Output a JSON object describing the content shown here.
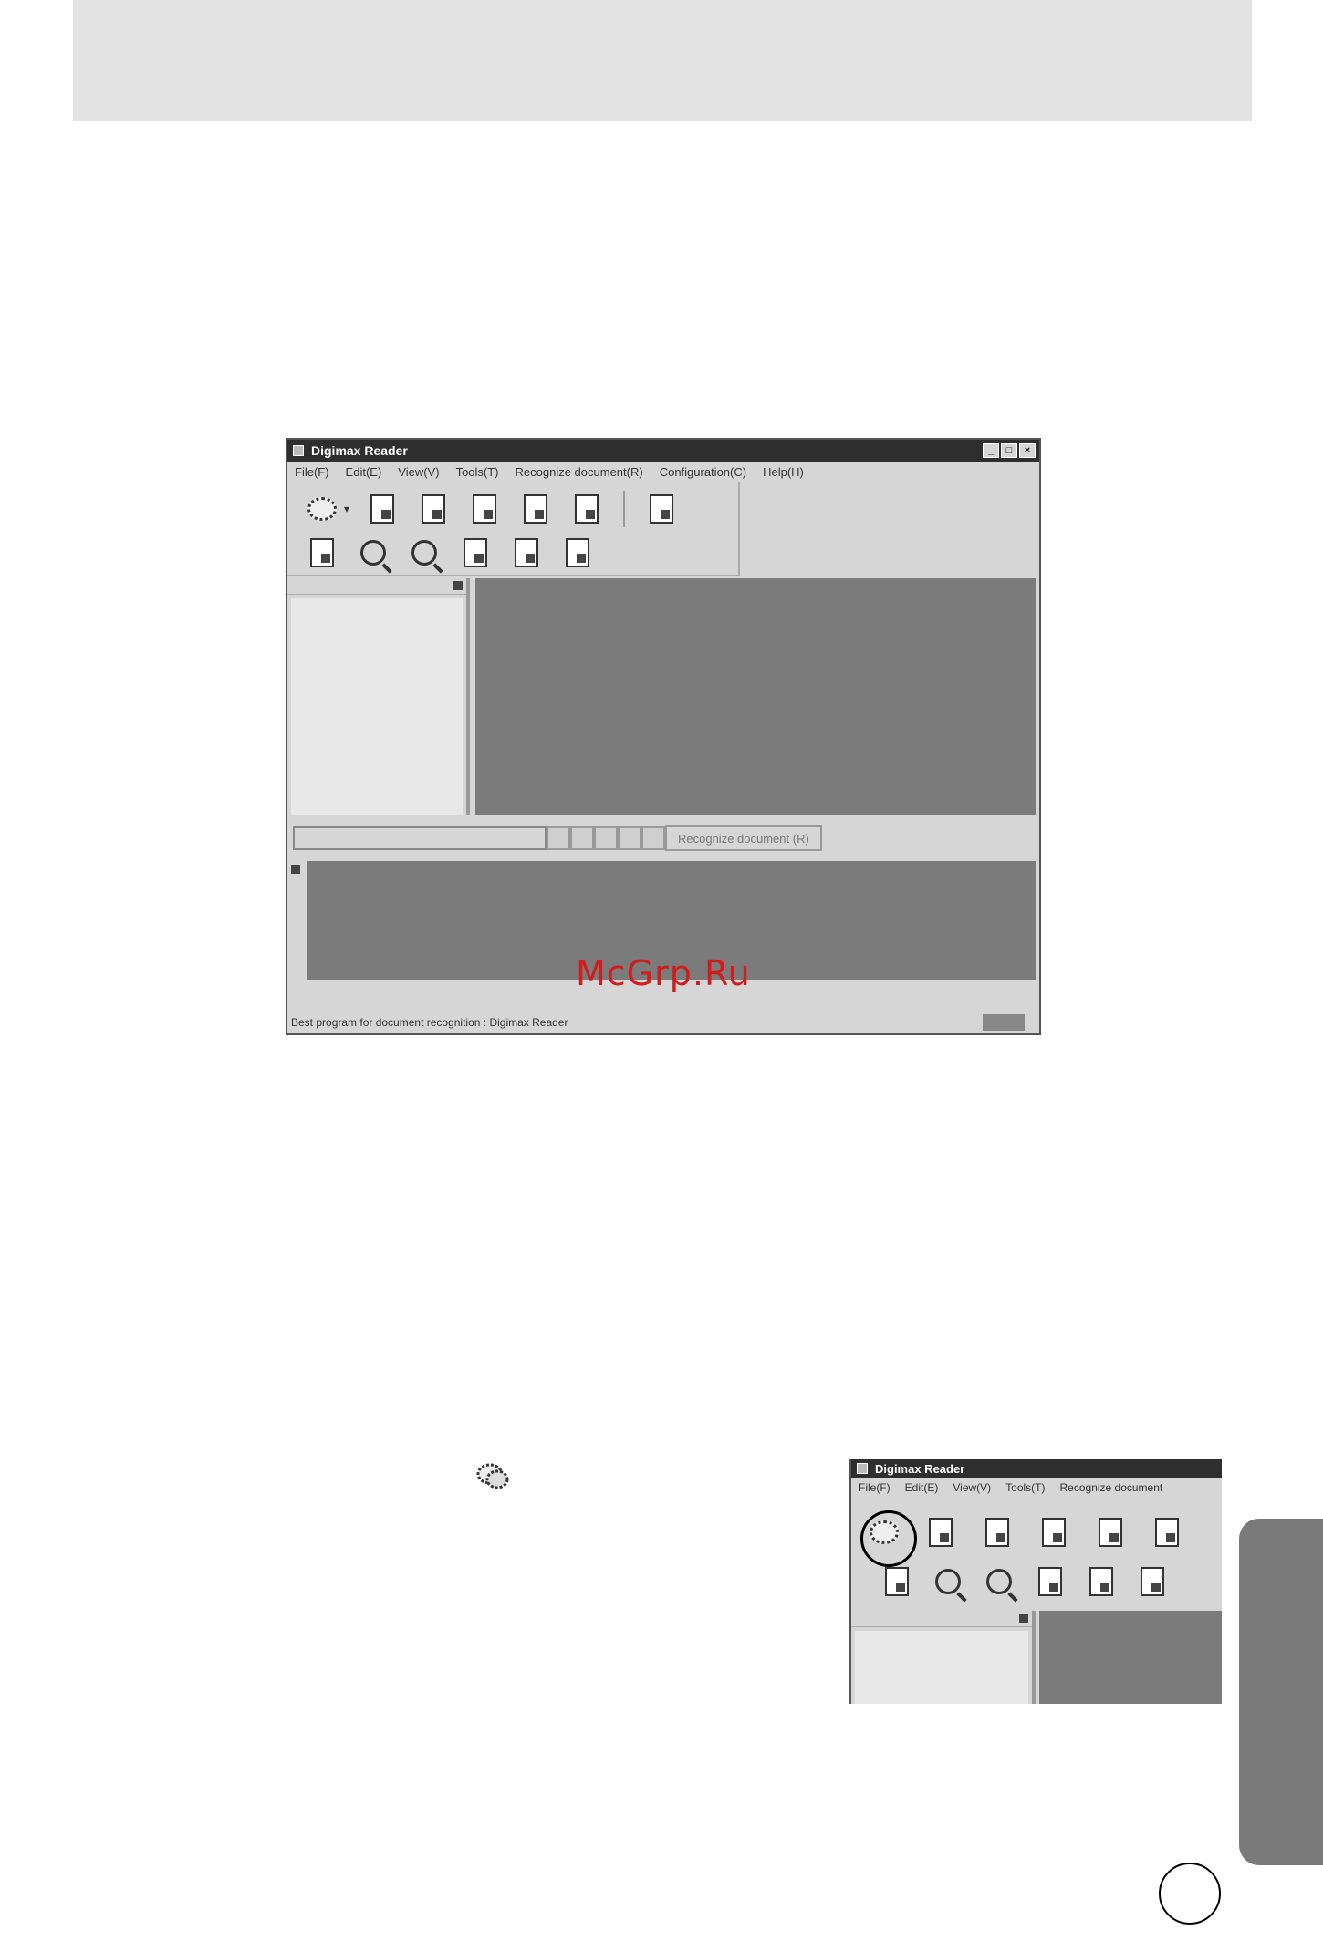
{
  "window": {
    "title": "Digimax Reader",
    "controls": [
      "_",
      "□",
      "×"
    ],
    "menu": [
      "File(F)",
      "Edit(E)",
      "View(V)",
      "Tools(T)",
      "Recognize document(R)",
      "Configuration(C)",
      "Help(H)"
    ],
    "nav_label": "Recognize document (R)",
    "status_text": "Best program for document recognition : Digimax Reader"
  },
  "watermark": "McGrp.Ru",
  "inset": {
    "title": "Digimax Reader",
    "menu": [
      "File(F)",
      "Edit(E)",
      "View(V)",
      "Tools(T)",
      "Recognize document"
    ]
  }
}
